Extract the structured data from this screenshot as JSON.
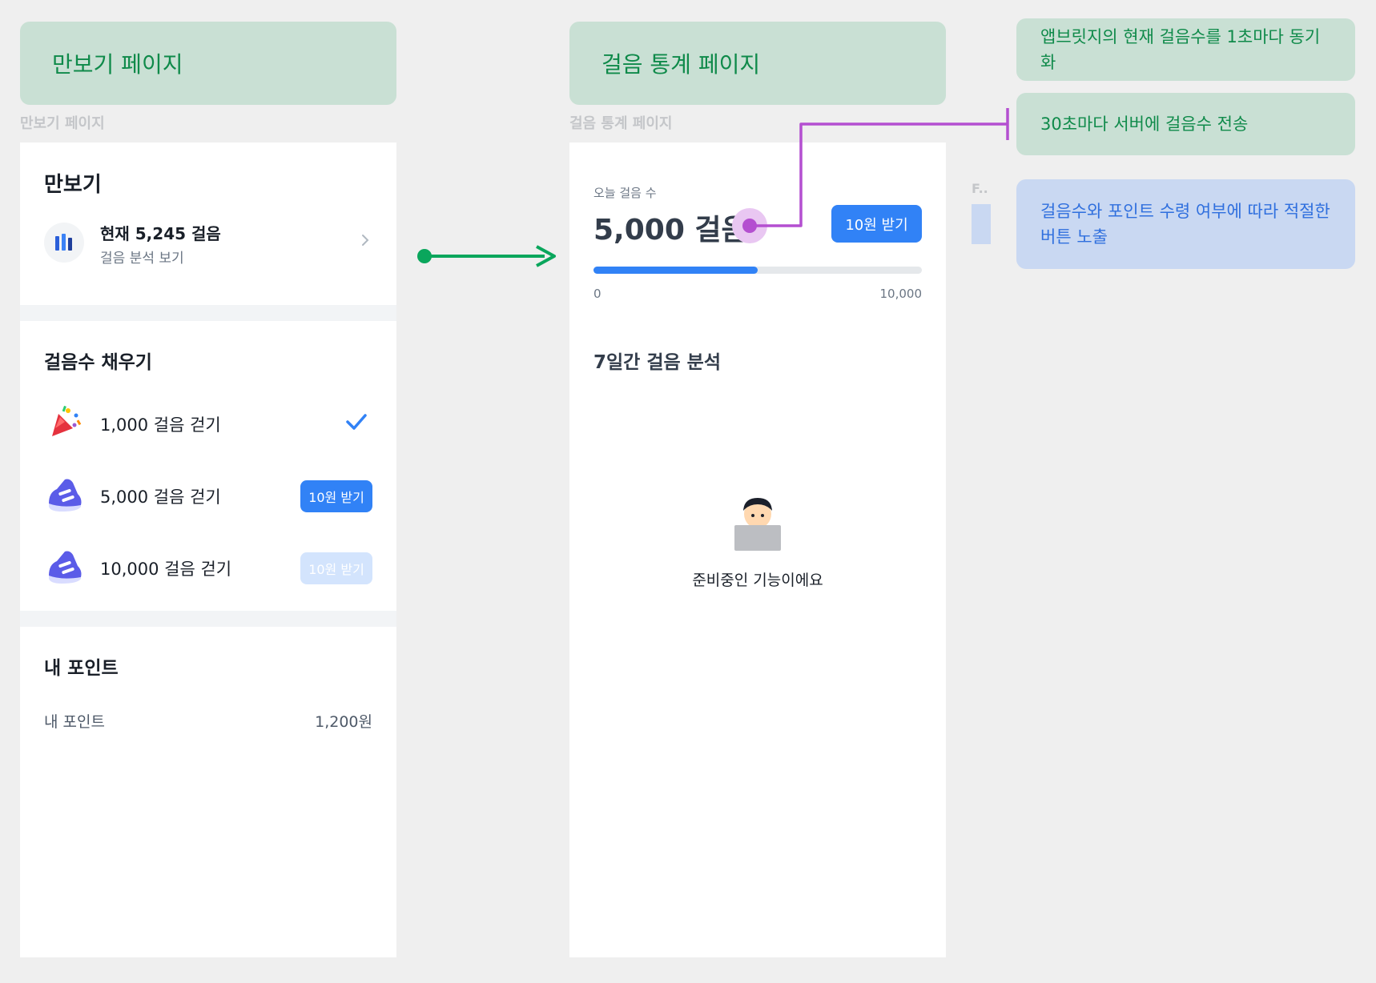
{
  "left": {
    "page_label": "만보기 페이지",
    "caption": "만보기 페이지",
    "header_title": "만보기",
    "current_steps": "현재 5,245 걸음",
    "analysis_link": "걸음 분석 보기",
    "fill_title": "걸음수 채우기",
    "missions": [
      {
        "label": "1,000 걸음 걷기",
        "status": "done"
      },
      {
        "label": "5,000 걸음 걷기",
        "button": "10원 받기",
        "state": "active"
      },
      {
        "label": "10,000 걸음 걷기",
        "button": "10원 받기",
        "state": "disabled"
      }
    ],
    "points_title": "내 포인트",
    "points_label": "내 포인트",
    "points_value": "1,200원"
  },
  "middle": {
    "page_label": "걸음 통계 페이지",
    "caption": "걸음 통계 페이지",
    "today_label": "오늘 걸음 수",
    "today_steps": "5,000 걸음",
    "reward_button": "10원 받기",
    "progress": {
      "value": 5000,
      "min": 0,
      "max": 10000,
      "fraction": 0.5
    },
    "progress_min_label": "0",
    "progress_max_label": "10,000",
    "analysis_title": "7일간 걸음 분석",
    "coming_soon": "준비중인 기능이에요"
  },
  "side": {
    "truncated_caption": "F..",
    "notes": [
      "앱브릿지의 현재 걸음수를 1초마다 동기화",
      "30초마다 서버에 걸음수 전송",
      [
        "걸음수와 포인트 수령 여부에 따라 적절한",
        "버튼 노출"
      ]
    ]
  },
  "colors": {
    "accent_blue": "#3182f6",
    "label_green": "#0f8a4a",
    "connector_purple": "#b44fd0",
    "arrow_green": "#0aa65c"
  },
  "icons": [
    "bar-chart-icon",
    "chevron-right-icon",
    "party-popper-icon",
    "checkmark-icon",
    "sneaker-icon",
    "person-laptop-icon",
    "arrow-right-icon"
  ]
}
